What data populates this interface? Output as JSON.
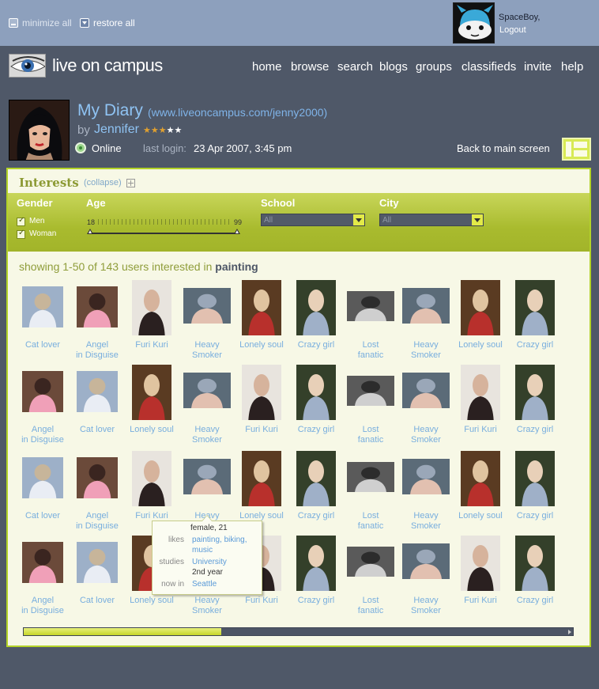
{
  "window_controls": {
    "minimize_all": "minimize all",
    "restore_all": "restore all"
  },
  "user": {
    "name": "SpaceBoy,",
    "logout": "Logout"
  },
  "site": {
    "logo": "live on campus"
  },
  "nav": [
    "home",
    "browse",
    "search",
    "blogs",
    "groups",
    "classifieds",
    "invite",
    "help"
  ],
  "profile": {
    "title": "My Diary",
    "url": "(www.liveoncampus.com/jenny2000)",
    "by": "by",
    "name": "Jennifer",
    "rating": 3,
    "rating_max": 5,
    "status": "Online",
    "last_login_label": "last login:",
    "last_login": "23 Apr 2007, 3:45 pm",
    "back": "Back to main screen"
  },
  "interests": {
    "title": "Interests",
    "collapse": "(collapse)",
    "filters": {
      "gender": {
        "label": "Gender",
        "options": [
          {
            "label": "Men",
            "checked": true
          },
          {
            "label": "Woman",
            "checked": true
          }
        ]
      },
      "age": {
        "label": "Age",
        "min": "18",
        "max": "99"
      },
      "school": {
        "label": "School",
        "value": "All"
      },
      "city": {
        "label": "City",
        "value": "All"
      }
    },
    "results_prefix": "showing 1-50 of 143 users interested in",
    "keyword": "painting"
  },
  "grid_rows": [
    [
      "Cat lover",
      "Angel\nin Disguise",
      "Furi Kuri",
      "Heavy\nSmoker",
      "Lonely soul",
      "Crazy girl",
      "Lost\nfanatic",
      "Heavy\nSmoker",
      "Lonely soul",
      "Crazy girl"
    ],
    [
      "Angel\nin Disguise",
      "Cat lover",
      "Lonely soul",
      "Heavy\nSmoker",
      "Furi Kuri",
      "Crazy girl",
      "Lost\nfanatic",
      "Heavy\nSmoker",
      "Furi Kuri",
      "Crazy girl"
    ],
    [
      "Cat lover",
      "Angel\nin Disguise",
      "Furi Kuri",
      "Heavy\nSmoker",
      "Lonely soul",
      "Crazy girl",
      "Lost\nfanatic",
      "Heavy\nSmoker",
      "Lonely soul",
      "Crazy girl"
    ],
    [
      "Angel\nin Disguise",
      "Cat lover",
      "Lonely soul",
      "Heavy\nSmoker",
      "Furi Kuri",
      "Crazy girl",
      "Lost\nfanatic",
      "Heavy\nSmoker",
      "Furi Kuri",
      "Crazy girl"
    ]
  ],
  "tooltip": {
    "header": "female, 21",
    "likes_label": "likes",
    "likes_line1": "painting, biking,",
    "likes_line2": "music",
    "studies_label": "studies",
    "studies_line1": "University",
    "studies_line2": "2nd year",
    "location_label": "now in",
    "location": "Seattle"
  },
  "scroll": {
    "position": 0.36
  },
  "colors": {
    "accent": "#b3d327",
    "link": "#78aede",
    "background": "#4f5868"
  }
}
